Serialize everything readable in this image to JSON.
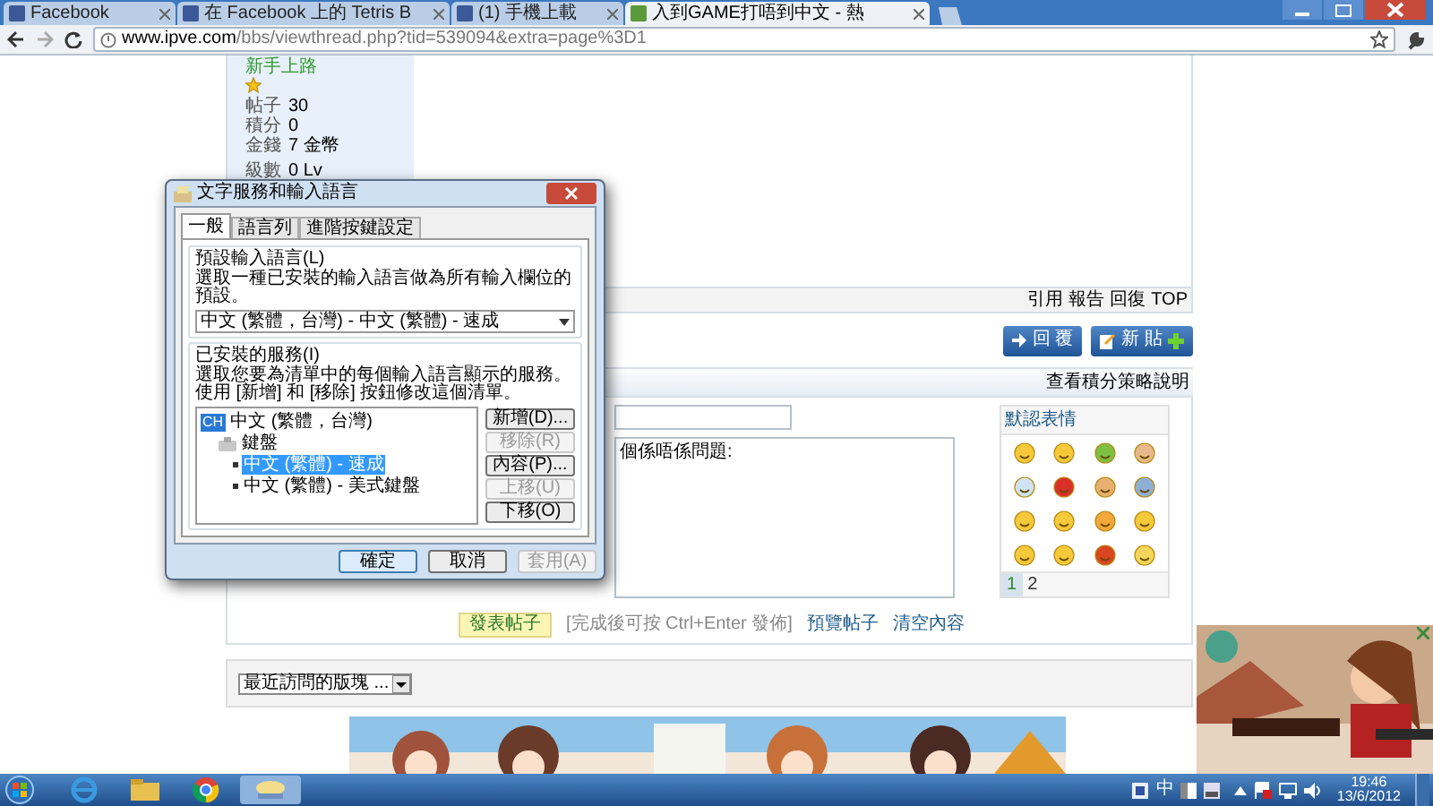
{
  "browser": {
    "tabs": [
      {
        "title": "Facebook",
        "selected": false
      },
      {
        "title": "在 Facebook 上的 Tetris B",
        "selected": false
      },
      {
        "title": "(1) 手機上載",
        "selected": false
      },
      {
        "title": "入到GAME打唔到中文 - 熱",
        "selected": true
      }
    ],
    "url_host": "www.ipve.com",
    "url_path": "/bbs/viewthread.php?tid=539094&extra=page%3D1"
  },
  "post": {
    "user_rank": "新手上路",
    "stats": [
      {
        "label": "帖子",
        "value": "30"
      },
      {
        "label": "積分",
        "value": "0"
      },
      {
        "label": "金錢",
        "value": "7 金幣"
      },
      {
        "label": "級數",
        "value": "0 Lv"
      }
    ],
    "actions": [
      "引用",
      "報告",
      "回復",
      "TOP"
    ]
  },
  "thread_buttons": [
    {
      "label": "回 覆",
      "kind": "reply"
    },
    {
      "label": "新 貼",
      "kind": "new"
    }
  ],
  "reply_form": {
    "header_link": "查看積分策略說明",
    "message": "個係唔係問題:",
    "emoticons": {
      "title": "默認表情",
      "pages": [
        {
          "label": "1",
          "selected": true
        },
        {
          "label": "2",
          "selected": false
        }
      ]
    },
    "submit": "發表帖子",
    "hint": "[完成後可按 Ctrl+Enter 發佈]",
    "links": [
      "預覽帖子",
      "清空內容"
    ]
  },
  "forum_jump": {
    "value": "最近訪問的版塊 ..."
  },
  "dialog": {
    "title": "文字服務和輸入語言",
    "tabs": [
      {
        "label": "一般",
        "selected": true
      },
      {
        "label": "語言列",
        "selected": false
      },
      {
        "label": "進階按鍵設定",
        "selected": false
      }
    ],
    "default_group": {
      "legend": "預設輸入語言(L)",
      "description": "選取一種已安裝的輸入語言做為所有輸入欄位的預設。",
      "dropdown": "中文 (繁體，台灣) - 中文 (繁體) - 速成"
    },
    "services_group": {
      "legend": "已安裝的服務(I)",
      "description": "選取您要為清單中的每個輸入語言顯示的服務。使用 [新增] 和 [移除] 按鈕修改這個清單。",
      "tree": [
        {
          "badge": "CH",
          "label": "中文 (繁體，台灣)",
          "children": [
            {
              "label": "鍵盤",
              "children": [
                {
                  "label": "中文 (繁體) - 速成",
                  "selected": true
                },
                {
                  "label": "中文 (繁體) - 美式鍵盤",
                  "selected": false
                }
              ]
            }
          ]
        }
      ],
      "buttons": [
        {
          "label": "新增(D)...",
          "disabled": false
        },
        {
          "label": "移除(R)",
          "disabled": true
        },
        {
          "label": "內容(P)...",
          "disabled": false
        },
        {
          "label": "上移(U)",
          "disabled": true
        },
        {
          "label": "下移(O)",
          "disabled": false
        }
      ]
    },
    "footer_buttons": [
      {
        "label": "確定",
        "disabled": false,
        "default": true
      },
      {
        "label": "取消",
        "disabled": false,
        "default": false
      },
      {
        "label": "套用(A)",
        "disabled": true,
        "default": false
      }
    ]
  },
  "taskbar": {
    "ime": "中",
    "time": "19:46",
    "date": "13/6/2012"
  }
}
